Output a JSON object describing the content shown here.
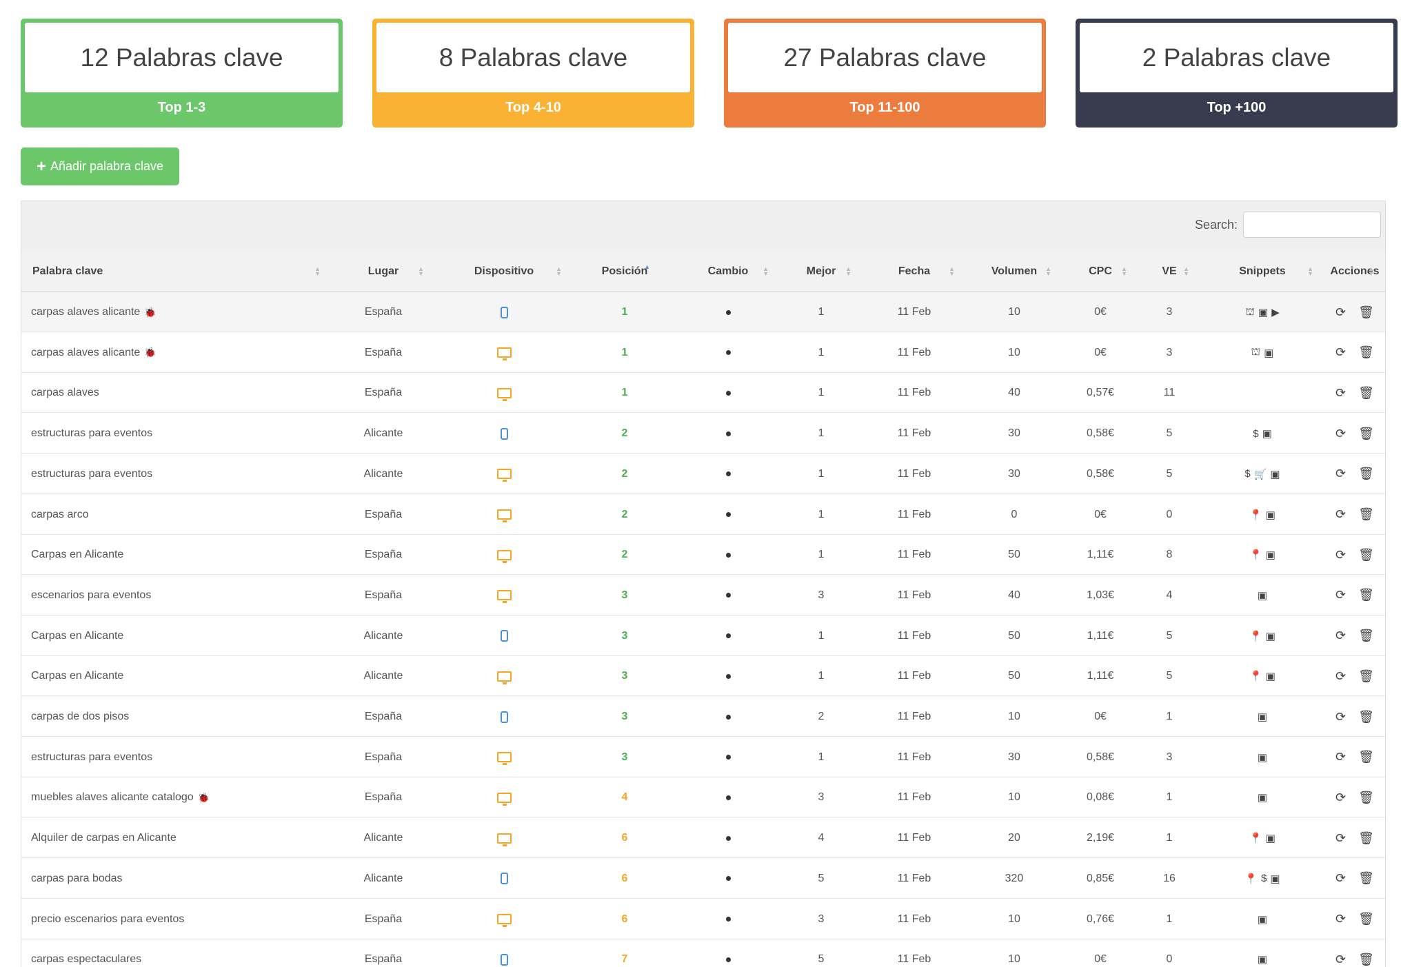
{
  "colors": {
    "green": "#6cc66a",
    "yellow": "#f9b233",
    "orange": "#ec7b3e",
    "dark": "#373b4d",
    "pos_green": "#4caf50",
    "pos_yellow": "#f5a623",
    "mobile": "#4a90e2",
    "desktop": "#f5a623"
  },
  "summary": [
    {
      "count": "12 Palabras clave",
      "label": "Top 1-3",
      "color": "#6cc66a"
    },
    {
      "count": "8 Palabras clave",
      "label": "Top 4-10",
      "color": "#f9b233"
    },
    {
      "count": "27 Palabras clave",
      "label": "Top 11-100",
      "color": "#ec7b3e"
    },
    {
      "count": "2 Palabras clave",
      "label": "Top +100",
      "color": "#373b4d"
    }
  ],
  "add_button": {
    "label": "Añadir palabra clave"
  },
  "search": {
    "label": "Search:",
    "value": ""
  },
  "table": {
    "headers": [
      "Palabra clave",
      "Lugar",
      "Dispositivo",
      "Posición",
      "Cambio",
      "Mejor",
      "Fecha",
      "Volumen",
      "CPC",
      "VE",
      "Snippets",
      "Acciones"
    ],
    "sorted_column": "Posición",
    "rows": [
      {
        "kw": "carpas alaves alicante",
        "flag": true,
        "lugar": "España",
        "device": "mobile",
        "pos": "1",
        "mejor": "1",
        "fecha": "11 Feb",
        "vol": "10",
        "cpc": "0€",
        "ve": "3",
        "snippets": [
          "local-pack-icon",
          "image-icon",
          "video-icon"
        ]
      },
      {
        "kw": "carpas alaves alicante",
        "flag": true,
        "lugar": "España",
        "device": "desktop",
        "pos": "1",
        "mejor": "1",
        "fecha": "11 Feb",
        "vol": "10",
        "cpc": "0€",
        "ve": "3",
        "snippets": [
          "local-pack-icon",
          "image-icon"
        ]
      },
      {
        "kw": "carpas alaves",
        "flag": false,
        "lugar": "España",
        "device": "desktop",
        "pos": "1",
        "mejor": "1",
        "fecha": "11 Feb",
        "vol": "40",
        "cpc": "0,57€",
        "ve": "11",
        "snippets": []
      },
      {
        "kw": "estructuras para eventos",
        "flag": false,
        "lugar": "Alicante",
        "device": "mobile",
        "pos": "2",
        "mejor": "1",
        "fecha": "11 Feb",
        "vol": "30",
        "cpc": "0,58€",
        "ve": "5",
        "snippets": [
          "dollar-icon",
          "image-icon"
        ]
      },
      {
        "kw": "estructuras para eventos",
        "flag": false,
        "lugar": "Alicante",
        "device": "desktop",
        "pos": "2",
        "mejor": "1",
        "fecha": "11 Feb",
        "vol": "30",
        "cpc": "0,58€",
        "ve": "5",
        "snippets": [
          "dollar-icon",
          "cart-icon",
          "image-icon"
        ]
      },
      {
        "kw": "carpas arco",
        "flag": false,
        "lugar": "España",
        "device": "desktop",
        "pos": "2",
        "mejor": "1",
        "fecha": "11 Feb",
        "vol": "0",
        "cpc": "0€",
        "ve": "0",
        "snippets": [
          "map-pin-icon",
          "image-icon"
        ]
      },
      {
        "kw": "Carpas en Alicante",
        "flag": false,
        "lugar": "España",
        "device": "desktop",
        "pos": "2",
        "mejor": "1",
        "fecha": "11 Feb",
        "vol": "50",
        "cpc": "1,11€",
        "ve": "8",
        "snippets": [
          "map-pin-icon",
          "image-icon"
        ]
      },
      {
        "kw": "escenarios para eventos",
        "flag": false,
        "lugar": "España",
        "device": "desktop",
        "pos": "3",
        "mejor": "3",
        "fecha": "11 Feb",
        "vol": "40",
        "cpc": "1,03€",
        "ve": "4",
        "snippets": [
          "image-icon"
        ]
      },
      {
        "kw": "Carpas en Alicante",
        "flag": false,
        "lugar": "Alicante",
        "device": "mobile",
        "pos": "3",
        "mejor": "1",
        "fecha": "11 Feb",
        "vol": "50",
        "cpc": "1,11€",
        "ve": "5",
        "snippets": [
          "map-pin-icon",
          "image-icon"
        ]
      },
      {
        "kw": "Carpas en Alicante",
        "flag": false,
        "lugar": "Alicante",
        "device": "desktop",
        "pos": "3",
        "mejor": "1",
        "fecha": "11 Feb",
        "vol": "50",
        "cpc": "1,11€",
        "ve": "5",
        "snippets": [
          "map-pin-icon",
          "image-icon"
        ]
      },
      {
        "kw": "carpas de dos pisos",
        "flag": false,
        "lugar": "España",
        "device": "mobile",
        "pos": "3",
        "mejor": "2",
        "fecha": "11 Feb",
        "vol": "10",
        "cpc": "0€",
        "ve": "1",
        "snippets": [
          "image-icon"
        ]
      },
      {
        "kw": "estructuras para eventos",
        "flag": false,
        "lugar": "España",
        "device": "desktop",
        "pos": "3",
        "mejor": "1",
        "fecha": "11 Feb",
        "vol": "30",
        "cpc": "0,58€",
        "ve": "3",
        "snippets": [
          "image-icon"
        ]
      },
      {
        "kw": "muebles alaves alicante catalogo",
        "flag": true,
        "lugar": "España",
        "device": "desktop",
        "pos": "4",
        "mejor": "3",
        "fecha": "11 Feb",
        "vol": "10",
        "cpc": "0,08€",
        "ve": "1",
        "snippets": [
          "image-icon"
        ]
      },
      {
        "kw": "Alquiler de carpas en Alicante",
        "flag": false,
        "lugar": "Alicante",
        "device": "desktop",
        "pos": "6",
        "mejor": "4",
        "fecha": "11 Feb",
        "vol": "20",
        "cpc": "2,19€",
        "ve": "1",
        "snippets": [
          "map-pin-icon",
          "image-icon"
        ]
      },
      {
        "kw": "carpas para bodas",
        "flag": false,
        "lugar": "Alicante",
        "device": "mobile",
        "pos": "6",
        "mejor": "5",
        "fecha": "11 Feb",
        "vol": "320",
        "cpc": "0,85€",
        "ve": "16",
        "snippets": [
          "map-pin-icon",
          "dollar-icon",
          "image-icon"
        ]
      },
      {
        "kw": "precio escenarios para eventos",
        "flag": false,
        "lugar": "España",
        "device": "desktop",
        "pos": "6",
        "mejor": "3",
        "fecha": "11 Feb",
        "vol": "10",
        "cpc": "0,76€",
        "ve": "1",
        "snippets": [
          "image-icon"
        ]
      },
      {
        "kw": "carpas espectaculares",
        "flag": false,
        "lugar": "España",
        "device": "mobile",
        "pos": "7",
        "mejor": "5",
        "fecha": "11 Feb",
        "vol": "10",
        "cpc": "0€",
        "ve": "0",
        "snippets": [
          "image-icon"
        ]
      }
    ]
  }
}
